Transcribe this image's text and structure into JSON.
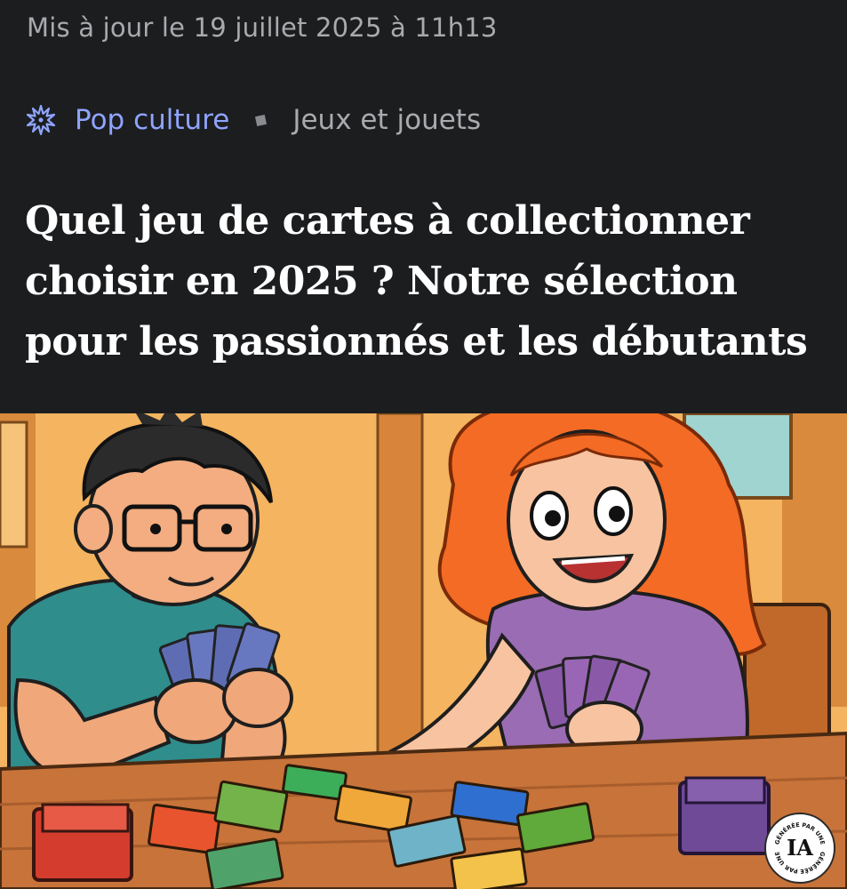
{
  "article": {
    "updated": "Mis à jour le 19 juillet 2025 à 11h13",
    "breadcrumb": {
      "category": "Pop culture",
      "category_icon": "sparkle-burst-icon",
      "subcategory": "Jeux et jouets"
    },
    "title": "Quel jeu de cartes à collectionner choisir en 2025 ? Notre sélection pour les passionnés et les débutants"
  },
  "hero": {
    "badge": {
      "label": "IA",
      "ring_text": "GÉNÉRÉE PAR UNE"
    }
  },
  "colors": {
    "background": "#1c1d1f",
    "meta_text": "#a9aaad",
    "category_link": "#8fa4ff",
    "title_text": "#ffffff"
  }
}
